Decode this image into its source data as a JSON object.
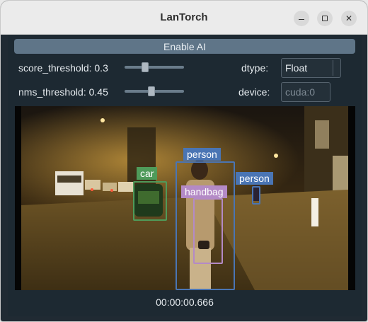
{
  "window": {
    "title": "LanTorch"
  },
  "controls": {
    "enable_ai_label": "Enable AI",
    "score_threshold_label": "score_threshold: 0.3",
    "score_threshold_value": 0.3,
    "nms_threshold_label": "nms_threshold: 0.45",
    "nms_threshold_value": 0.45,
    "dtype_label": "dtype:",
    "dtype_value": "Float",
    "device_label": "device:",
    "device_value": "cuda:0"
  },
  "detections": [
    {
      "label": "car",
      "color": "#4f9b5a"
    },
    {
      "label": "person",
      "color": "#4a75b4"
    },
    {
      "label": "person",
      "color": "#4a75b4"
    },
    {
      "label": "handbag",
      "color": "#b48ac6"
    }
  ],
  "player": {
    "timestamp": "00:00:00.666"
  }
}
